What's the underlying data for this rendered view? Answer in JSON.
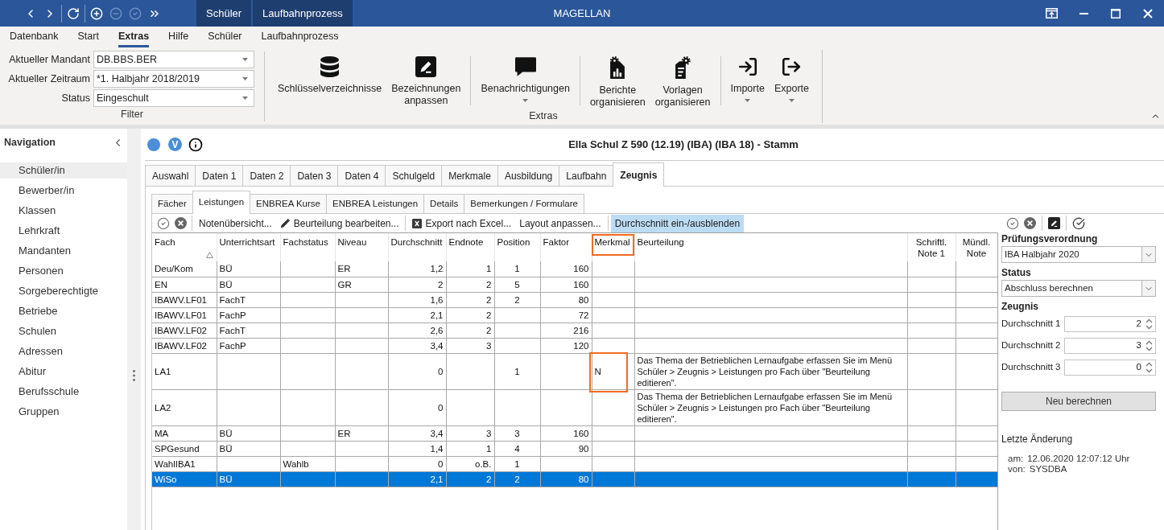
{
  "titlebar": {
    "quick_access": [
      {
        "buttons": [
          {
            "disabled": false
          },
          {
            "disabled": false
          }
        ]
      },
      {
        "buttons": [
          {
            "disabled": false
          }
        ]
      },
      {
        "buttons": [
          {
            "disabled": false
          },
          {
            "disabled": true
          },
          {
            "disabled": true
          },
          {
            "disabled": false
          }
        ]
      }
    ],
    "context_tabs": [
      "Schüler",
      "Laufbahnprozess"
    ],
    "title": "MAGELLAN"
  },
  "ribbon": {
    "menu": [
      {
        "label": "Datenbank",
        "selected": false
      },
      {
        "label": "Start",
        "selected": false
      },
      {
        "label": "Extras",
        "selected": true
      },
      {
        "label": "Hilfe",
        "selected": false
      },
      {
        "label": "Schüler",
        "selected": false
      },
      {
        "label": "Laufbahnprozess",
        "selected": false
      }
    ],
    "filter": {
      "label": "Filter",
      "fields": [
        {
          "label": "Aktueller Mandant",
          "value": "DB.BBS.BER"
        },
        {
          "label": "Aktueller Zeitraum",
          "value": "*1. Halbjahr 2018/2019"
        },
        {
          "label": "Status",
          "value": "Eingeschult"
        }
      ]
    },
    "extras": {
      "label": "Extras",
      "sections": [
        {
          "buttons": [
            {
              "label": "Schlüsselverzeichnisse",
              "dropdown": false
            },
            {
              "label": "Bezeichnungen anpassen",
              "dropdown": false
            }
          ]
        },
        {
          "buttons": [
            {
              "label": "Benachrichtigungen",
              "dropdown": true
            }
          ]
        },
        {
          "buttons": [
            {
              "label": "Berichte organisieren",
              "dropdown": false
            },
            {
              "label": "Vorlagen organisieren",
              "dropdown": false
            }
          ]
        },
        {
          "buttons": [
            {
              "label": "Importe",
              "dropdown": true
            },
            {
              "label": "Exporte",
              "dropdown": true
            }
          ]
        }
      ]
    }
  },
  "navigation": {
    "title": "Navigation",
    "items": [
      {
        "label": "Schüler/in",
        "selected": true
      },
      {
        "label": "Bewerber/in",
        "selected": false
      },
      {
        "label": "Klassen",
        "selected": false
      },
      {
        "label": "Lehrkraft",
        "selected": false
      },
      {
        "label": "Mandanten",
        "selected": false
      },
      {
        "label": "Personen",
        "selected": false
      },
      {
        "label": "Sorgeberechtigte",
        "selected": false
      },
      {
        "label": "Betriebe",
        "selected": false
      },
      {
        "label": "Schulen",
        "selected": false
      },
      {
        "label": "Adressen",
        "selected": false
      },
      {
        "label": "Abitur",
        "selected": false
      },
      {
        "label": "Berufsschule",
        "selected": false
      },
      {
        "label": "Gruppen",
        "selected": false
      }
    ]
  },
  "record": {
    "badge": "V",
    "title": "Ella Schul Z 590 (12.19) (IBA) (IBA 18) - Stamm",
    "tabs": [
      {
        "label": "Auswahl",
        "selected": false
      },
      {
        "label": "Daten 1",
        "selected": false
      },
      {
        "label": "Daten 2",
        "selected": false
      },
      {
        "label": "Daten 3",
        "selected": false
      },
      {
        "label": "Daten 4",
        "selected": false
      },
      {
        "label": "Schulgeld",
        "selected": false
      },
      {
        "label": "Merkmale",
        "selected": false
      },
      {
        "label": "Ausbildung",
        "selected": false
      },
      {
        "label": "Laufbahn",
        "selected": false
      },
      {
        "label": "Zeugnis",
        "selected": true
      }
    ],
    "subtabs": [
      {
        "label": "Fächer",
        "selected": false
      },
      {
        "label": "Leistungen",
        "selected": true
      },
      {
        "label": "ENBREA Kurse",
        "selected": false
      },
      {
        "label": "ENBREA Leistungen",
        "selected": false
      },
      {
        "label": "Details",
        "selected": false
      },
      {
        "label": "Bemerkungen / Formulare",
        "selected": false
      }
    ],
    "toolbar": [
      {
        "items": [
          {
            "pressed": false
          },
          {
            "pressed": false
          }
        ]
      },
      {
        "items": [
          {
            "label": "Notenübersicht...",
            "pressed": false
          },
          {
            "label": "Beurteilung bearbeiten...",
            "pressed": false
          }
        ]
      },
      {
        "items": [
          {
            "label": "Export nach Excel...",
            "pressed": false
          },
          {
            "label": "Layout anpassen...",
            "pressed": false
          }
        ]
      },
      {
        "items": [
          {
            "label": "Durchschnitt ein-/ausblenden",
            "pressed": true
          }
        ]
      }
    ],
    "table": {
      "columns": [
        {
          "label": "Fach",
          "sorted": true,
          "highlighted": false
        },
        {
          "label": "Unterrichtsart",
          "sorted": false,
          "highlighted": false
        },
        {
          "label": "Fachstatus",
          "sorted": false,
          "highlighted": false
        },
        {
          "label": "Niveau",
          "sorted": false,
          "highlighted": false
        },
        {
          "label": "Durchschnitt",
          "sorted": false,
          "highlighted": false
        },
        {
          "label": "Endnote",
          "sorted": false,
          "highlighted": false
        },
        {
          "label": "Position",
          "sorted": false,
          "highlighted": false
        },
        {
          "label": "Faktor",
          "sorted": false,
          "highlighted": false
        },
        {
          "label": "Merkmal",
          "sorted": false,
          "highlighted": true
        },
        {
          "label": "Beurteilung",
          "sorted": false,
          "highlighted": false
        },
        {
          "label": "Schriftl. Note 1",
          "sorted": false,
          "highlighted": false
        },
        {
          "label": "Mündl. Note",
          "sorted": false,
          "highlighted": false
        }
      ],
      "rows": [
        {
          "cells": [
            "Deu/Kom",
            "BÜ",
            null,
            "ER",
            "1,2",
            "1",
            "1",
            "160",
            null,
            null,
            null,
            null
          ],
          "selected": false,
          "merkmal_highlighted": false
        },
        {
          "cells": [
            "EN",
            "BÜ",
            null,
            "GR",
            "2",
            "2",
            "5",
            "160",
            null,
            null,
            null,
            null
          ],
          "selected": false,
          "merkmal_highlighted": false
        },
        {
          "cells": [
            "IBAWV.LF01",
            "FachT",
            null,
            null,
            "1,6",
            "2",
            "2",
            "80",
            null,
            null,
            null,
            null
          ],
          "selected": false,
          "merkmal_highlighted": false
        },
        {
          "cells": [
            "IBAWV.LF01",
            "FachP",
            null,
            null,
            "2,1",
            "2",
            null,
            "72",
            null,
            null,
            null,
            null
          ],
          "selected": false,
          "merkmal_highlighted": false
        },
        {
          "cells": [
            "IBAWV.LF02",
            "FachT",
            null,
            null,
            "2,6",
            "2",
            null,
            "216",
            null,
            null,
            null,
            null
          ],
          "selected": false,
          "merkmal_highlighted": false
        },
        {
          "cells": [
            "IBAWV.LF02",
            "FachP",
            null,
            null,
            "3,4",
            "3",
            null,
            "120",
            null,
            null,
            null,
            null
          ],
          "selected": false,
          "merkmal_highlighted": false
        },
        {
          "cells": [
            "LA1",
            null,
            null,
            null,
            "0",
            null,
            "1",
            null,
            "N",
            "Das Thema der Betrieblichen Lernaufgabe erfassen Sie im Menü Schüler > Zeugnis > Leistungen pro Fach über \"Beurteilung editieren\".",
            null,
            null
          ],
          "selected": false,
          "merkmal_highlighted": true
        },
        {
          "cells": [
            "LA2",
            null,
            null,
            null,
            "0",
            null,
            null,
            null,
            null,
            "Das Thema der Betrieblichen Lernaufgabe erfassen Sie im Menü Schüler > Zeugnis > Leistungen pro Fach über \"Beurteilung editieren\".",
            null,
            null
          ],
          "selected": false,
          "merkmal_highlighted": false
        },
        {
          "cells": [
            "MA",
            "BÜ",
            null,
            "ER",
            "3,4",
            "3",
            "3",
            "160",
            null,
            null,
            null,
            null
          ],
          "selected": false,
          "merkmal_highlighted": false
        },
        {
          "cells": [
            "SPGesund",
            "BÜ",
            null,
            null,
            "1,4",
            "1",
            "4",
            "90",
            null,
            null,
            null,
            null
          ],
          "selected": false,
          "merkmal_highlighted": false
        },
        {
          "cells": [
            "WahlIBA1",
            null,
            "Wahlb",
            null,
            "0",
            "o.B.",
            "1",
            null,
            null,
            null,
            null,
            null
          ],
          "selected": false,
          "merkmal_highlighted": false
        },
        {
          "cells": [
            "WiSo",
            "BÜ",
            null,
            null,
            "2,1",
            "2",
            "2",
            "80",
            null,
            null,
            null,
            null
          ],
          "selected": true,
          "merkmal_highlighted": false
        }
      ]
    }
  },
  "side_panel": {
    "exam_regulation": {
      "label": "Prüfungsverordnung",
      "value": "IBA Halbjahr 2020"
    },
    "status": {
      "label": "Status",
      "value": "Abschluss berechnen"
    },
    "certificate": {
      "label": "Zeugnis",
      "averages": [
        {
          "label": "Durchschnitt 1",
          "value": "2"
        },
        {
          "label": "Durchschnitt 2",
          "value": "3"
        },
        {
          "label": "Durchschnitt 3",
          "value": "0"
        }
      ]
    },
    "recalculate": "Neu berechnen",
    "last_change": {
      "label": "Letzte Änderung",
      "entries": [
        {
          "label": "am:",
          "value": "12.06.2020 12:07:12 Uhr"
        },
        {
          "label": "von:",
          "value": "SYSDBA"
        }
      ]
    }
  }
}
